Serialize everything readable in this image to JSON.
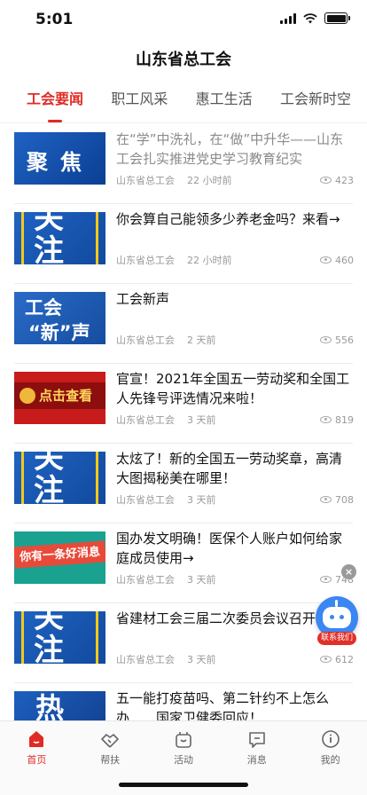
{
  "status_bar": {
    "time": "5:01"
  },
  "header": {
    "title": "山东省总工会"
  },
  "tabs": [
    {
      "label": "工会要闻",
      "active": true
    },
    {
      "label": "职工风采",
      "active": false
    },
    {
      "label": "惠工生活",
      "active": false
    },
    {
      "label": "工会新时空",
      "active": false
    }
  ],
  "news": [
    {
      "title": "在“学”中洗礼，在“做”中升华——山东工会扎实推进党史学习教育纪实",
      "source": "山东省总工会",
      "time": "22 小时前",
      "views": "423",
      "thumb_text": "聚焦",
      "read": true
    },
    {
      "title": "你会算自己能领多少养老金吗？来看→",
      "source": "山东省总工会",
      "time": "22 小时前",
      "views": "460",
      "thumb_text_1": "关",
      "thumb_text_2": "注",
      "read": false
    },
    {
      "title": "工会新声",
      "source": "山东省总工会",
      "time": "2 天前",
      "views": "556",
      "thumb_text_1": "工会",
      "thumb_text_2": "“新”声",
      "read": false
    },
    {
      "title": "官宣！2021年全国五一劳动奖和全国工人先锋号评选情况来啦！",
      "source": "山东省总工会",
      "time": "3 天前",
      "views": "819",
      "thumb_text": "点击查看",
      "read": false
    },
    {
      "title": "太炫了！新的全国五一劳动奖章，高清大图揭秘美在哪里！",
      "source": "山东省总工会",
      "time": "3 天前",
      "views": "708",
      "thumb_text_1": "关",
      "thumb_text_2": "注",
      "read": false
    },
    {
      "title": "国办发文明确！医保个人账户如何给家庭成员使用→",
      "source": "山东省总工会",
      "time": "3 天前",
      "views": "748",
      "thumb_text": "你有一条好消息",
      "read": false
    },
    {
      "title": "省建材工会三届二次委员会议召开",
      "source": "山东省总工会",
      "time": "3 天前",
      "views": "612",
      "thumb_text_1": "关",
      "thumb_text_2": "注",
      "read": false
    },
    {
      "title": "五一能打疫苗吗、第二针约不上怎么办……国家卫健委回应！",
      "source": "",
      "time": "",
      "views": "",
      "thumb_text": "热",
      "read": false
    }
  ],
  "assistant": {
    "label": "联系我们",
    "close": "×"
  },
  "tab_bar": [
    {
      "label": "首页",
      "icon": "home-icon",
      "active": true
    },
    {
      "label": "帮扶",
      "icon": "handshake-icon",
      "active": false
    },
    {
      "label": "活动",
      "icon": "activity-bag-icon",
      "active": false
    },
    {
      "label": "消息",
      "icon": "message-icon",
      "active": false
    },
    {
      "label": "我的",
      "icon": "profile-icon",
      "active": false
    }
  ],
  "colors": {
    "accent": "#e02b25",
    "thumb_blue": "#1f62c3"
  }
}
